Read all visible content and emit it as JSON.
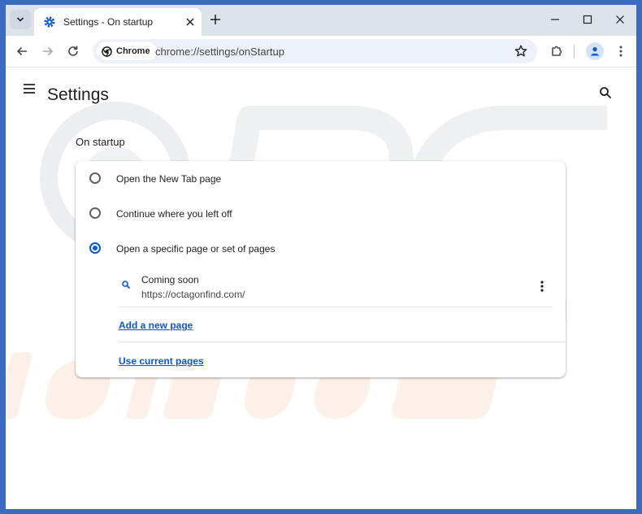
{
  "tab": {
    "title": "Settings - On startup"
  },
  "omnibox": {
    "chip_label": "Chrome",
    "url": "chrome://settings/onStartup"
  },
  "settings": {
    "title": "Settings",
    "section_title": "On startup",
    "options": [
      {
        "label": "Open the New Tab page",
        "checked": false
      },
      {
        "label": "Continue where you left off",
        "checked": false
      },
      {
        "label": "Open a specific page or set of pages",
        "checked": true
      }
    ],
    "startup_page": {
      "title": "Coming soon",
      "url": "https://octagonfind.com/"
    },
    "add_page_link": "Add a new page",
    "use_current_link": "Use current pages"
  },
  "colors": {
    "accent": "#0b57d0",
    "frame": "#dde3ea",
    "desktop": "#3b6bbf"
  }
}
